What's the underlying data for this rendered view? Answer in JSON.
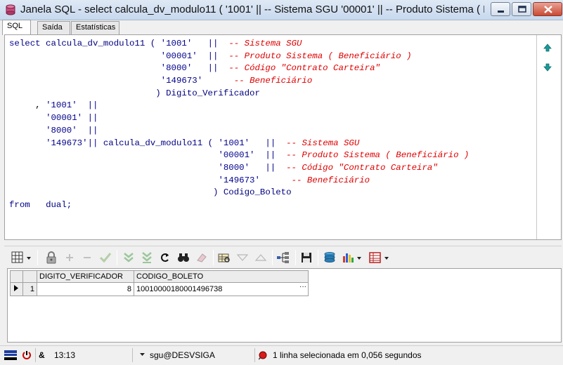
{
  "window": {
    "title": "Janela SQL - select calcula_dv_modulo11 ( '1001' || -- Sistema SGU '00001' || -- Produto Sistema ( B..."
  },
  "tabs": [
    {
      "label": "SQL",
      "active": true
    },
    {
      "label": "Saída",
      "active": false
    },
    {
      "label": "Estatísticas",
      "active": false
    }
  ],
  "editor": {
    "lines": [
      [
        {
          "t": "kw",
          "v": "select"
        },
        {
          "t": "id",
          "v": " calcula_dv_modulo11 ( "
        },
        {
          "t": "str",
          "v": "'1001'"
        },
        {
          "t": "pl",
          "v": "   "
        },
        {
          "t": "str",
          "v": "||"
        },
        {
          "t": "pl",
          "v": "  "
        },
        {
          "t": "cm",
          "v": "-- Sistema SGU"
        }
      ],
      [
        {
          "t": "pl",
          "v": "                             "
        },
        {
          "t": "str",
          "v": "'00001'"
        },
        {
          "t": "pl",
          "v": "  "
        },
        {
          "t": "str",
          "v": "||"
        },
        {
          "t": "pl",
          "v": "  "
        },
        {
          "t": "cm",
          "v": "-- Produto Sistema ( Beneficiário )"
        }
      ],
      [
        {
          "t": "pl",
          "v": "                             "
        },
        {
          "t": "str",
          "v": "'8000'"
        },
        {
          "t": "pl",
          "v": "   "
        },
        {
          "t": "str",
          "v": "||"
        },
        {
          "t": "pl",
          "v": "  "
        },
        {
          "t": "cm",
          "v": "-- Código \"Contrato Carteira\""
        }
      ],
      [
        {
          "t": "pl",
          "v": "                             "
        },
        {
          "t": "str",
          "v": "'149673'"
        },
        {
          "t": "pl",
          "v": "      "
        },
        {
          "t": "cm",
          "v": "-- Beneficiário"
        }
      ],
      [
        {
          "t": "pl",
          "v": "                            "
        },
        {
          "t": "id",
          "v": ") Digito_Verificador"
        }
      ],
      [
        {
          "t": "pl",
          "v": "     , "
        },
        {
          "t": "str",
          "v": "'1001'"
        },
        {
          "t": "pl",
          "v": "  "
        },
        {
          "t": "str",
          "v": "||"
        }
      ],
      [
        {
          "t": "pl",
          "v": "       "
        },
        {
          "t": "str",
          "v": "'00001'"
        },
        {
          "t": "pl",
          "v": " "
        },
        {
          "t": "str",
          "v": "||"
        }
      ],
      [
        {
          "t": "pl",
          "v": "       "
        },
        {
          "t": "str",
          "v": "'8000'"
        },
        {
          "t": "pl",
          "v": "  "
        },
        {
          "t": "str",
          "v": "||"
        }
      ],
      [
        {
          "t": "pl",
          "v": "       "
        },
        {
          "t": "str",
          "v": "'149673'"
        },
        {
          "t": "str",
          "v": "||"
        },
        {
          "t": "id",
          "v": " calcula_dv_modulo11 ( "
        },
        {
          "t": "str",
          "v": "'1001'"
        },
        {
          "t": "pl",
          "v": "   "
        },
        {
          "t": "str",
          "v": "||"
        },
        {
          "t": "pl",
          "v": "  "
        },
        {
          "t": "cm",
          "v": "-- Sistema SGU"
        }
      ],
      [
        {
          "t": "pl",
          "v": "                                        "
        },
        {
          "t": "str",
          "v": "'00001'"
        },
        {
          "t": "pl",
          "v": "  "
        },
        {
          "t": "str",
          "v": "||"
        },
        {
          "t": "pl",
          "v": "  "
        },
        {
          "t": "cm",
          "v": "-- Produto Sistema ( Beneficiário )"
        }
      ],
      [
        {
          "t": "pl",
          "v": "                                        "
        },
        {
          "t": "str",
          "v": "'8000'"
        },
        {
          "t": "pl",
          "v": "   "
        },
        {
          "t": "str",
          "v": "||"
        },
        {
          "t": "pl",
          "v": "  "
        },
        {
          "t": "cm",
          "v": "-- Código \"Contrato Carteira\""
        }
      ],
      [
        {
          "t": "pl",
          "v": "                                        "
        },
        {
          "t": "str",
          "v": "'149673'"
        },
        {
          "t": "pl",
          "v": "      "
        },
        {
          "t": "cm",
          "v": "-- Beneficiário"
        }
      ],
      [
        {
          "t": "pl",
          "v": "                                       "
        },
        {
          "t": "id",
          "v": ") Codigo_Boleto"
        }
      ],
      [
        {
          "t": "kw",
          "v": "from"
        },
        {
          "t": "pl",
          "v": "   "
        },
        {
          "t": "id",
          "v": "dual;"
        }
      ]
    ]
  },
  "results": {
    "columns": [
      "DIGITO_VERIFICADOR",
      "CODIGO_BOLETO"
    ],
    "rows": [
      {
        "num": "1",
        "cells": [
          "8",
          "10010000180001496738"
        ]
      }
    ]
  },
  "status": {
    "time": "13:13",
    "connection": "sgu@DESVSIGA",
    "message": "1 linha selecionada em 0,056 segundos"
  },
  "colors": {
    "keyword": "#00008b",
    "comment": "#e00000",
    "accent": "#1f5fbf"
  }
}
